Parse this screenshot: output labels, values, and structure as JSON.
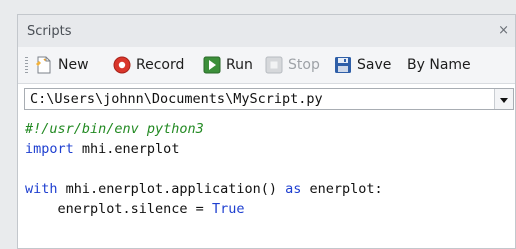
{
  "window": {
    "title": "Scripts",
    "close_glyph": "×"
  },
  "toolbar": {
    "new_label": "New",
    "record_label": "Record",
    "run_label": "Run",
    "stop_label": "Stop",
    "save_label": "Save",
    "byname_label": "By Name"
  },
  "path": {
    "value": "C:\\Users\\johnn\\Documents\\MyScript.py"
  },
  "editor": {
    "line1": "#!/usr/bin/env python3",
    "line2_kw": "import",
    "line2_rest": " mhi.enerplot",
    "line4_kw1": "with",
    "line4_mid": " mhi.enerplot.application() ",
    "line4_kw2": "as",
    "line4_rest": " enerplot:",
    "line5_rest": "    enerplot.silence = ",
    "line5_kw": "True"
  },
  "colors": {
    "comment": "#238a23",
    "keyword": "#1e3fd0",
    "record_icon": "#d9362b",
    "run_icon": "#3c8f3a",
    "save_icon": "#2f5fa8"
  }
}
